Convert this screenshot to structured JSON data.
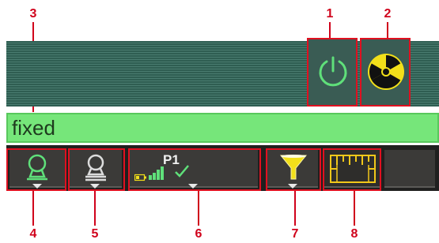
{
  "status": {
    "mode_text": "fixed"
  },
  "gnss": {
    "station_label": "P1",
    "battery_icon": "battery-icon",
    "signal_icon": "signal-bars-icon",
    "fix_icon": "check-icon"
  },
  "callouts": [
    "1",
    "2",
    "3",
    "4",
    "5",
    "6",
    "7",
    "8"
  ],
  "colors": {
    "status_bg": "#76e67a",
    "callout": "#d0021b",
    "power_icon": "#5fe07a",
    "radiation_icon": "#f2e01a",
    "filter_icon": "#f2e01a",
    "ruler_icon": "#f2c81a",
    "rover_active": "#5fe07a"
  }
}
